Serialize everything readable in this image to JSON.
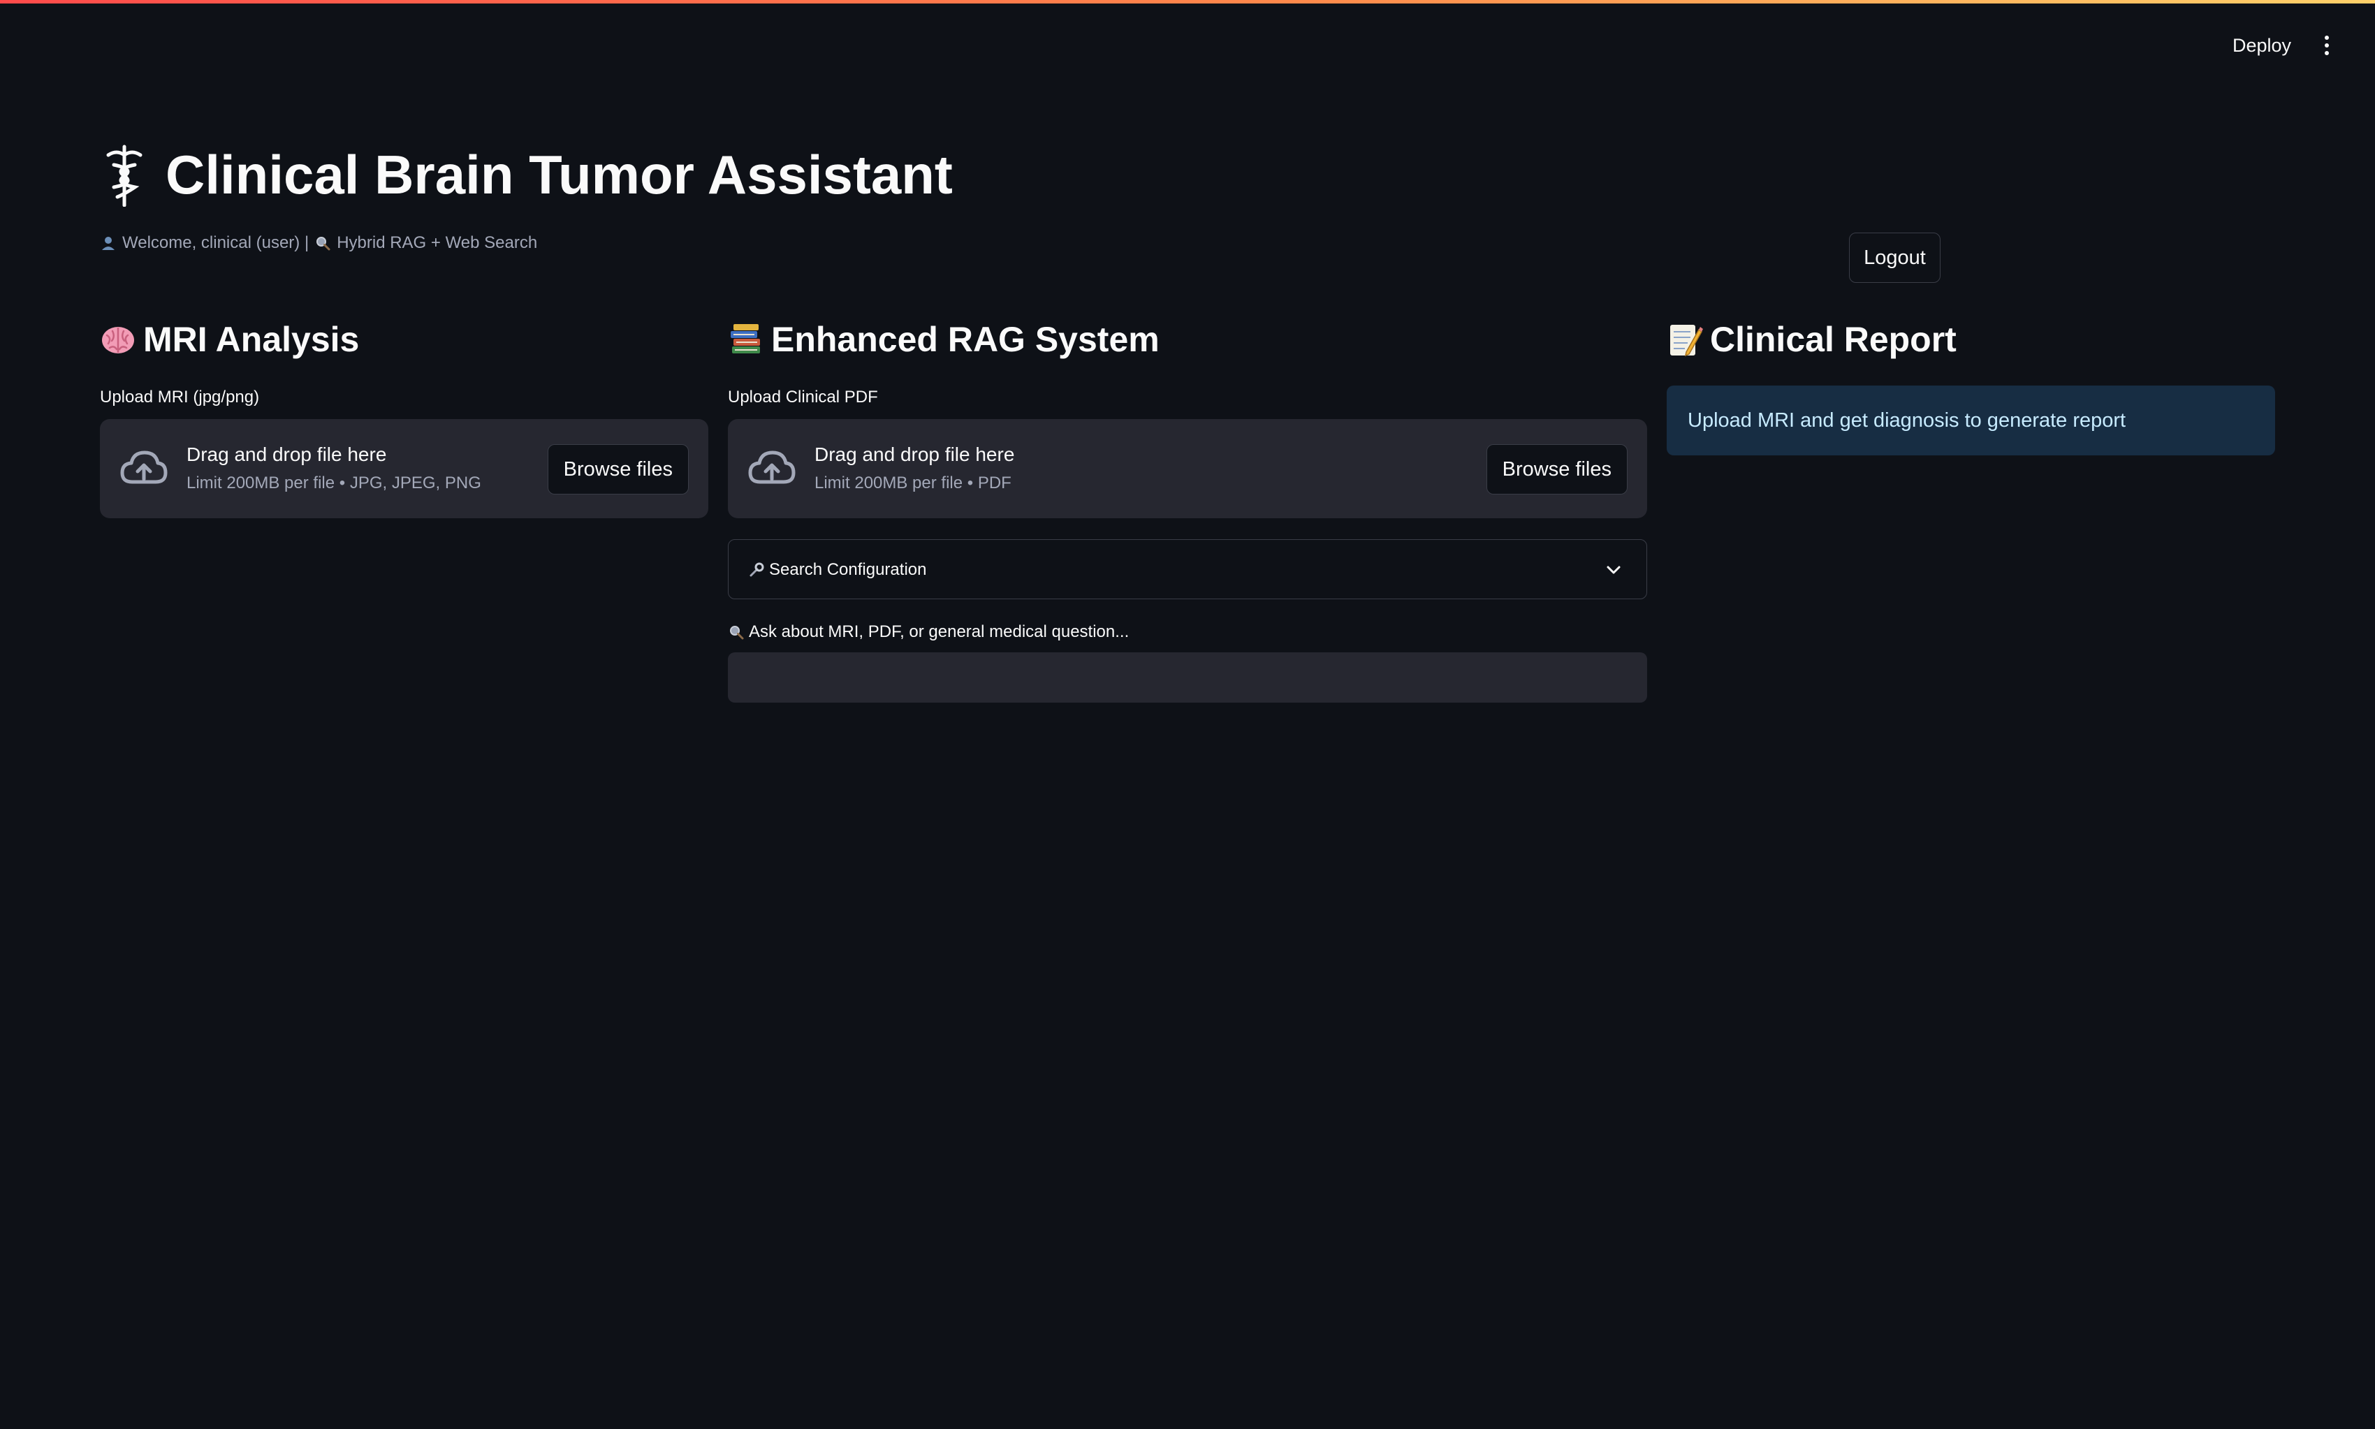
{
  "header": {
    "deploy_label": "Deploy",
    "menu_icon": "kebab-menu-icon"
  },
  "app": {
    "title": "Clinical Brain Tumor Assistant",
    "title_icon": "caduceus-icon",
    "welcome_text": "Welcome, clinical (user) |",
    "mode_text": "Hybrid RAG + Web Search",
    "logout_label": "Logout"
  },
  "mri_section": {
    "header": "MRI Analysis",
    "icon": "brain-icon",
    "upload_label": "Upload MRI (jpg/png)",
    "drag_text": "Drag and drop file here",
    "limit_text": "Limit 200MB per file • JPG, JPEG, PNG",
    "browse_label": "Browse files"
  },
  "rag_section": {
    "header": "Enhanced RAG System",
    "icon": "books-icon",
    "upload_label": "Upload Clinical PDF",
    "drag_text": "Drag and drop file here",
    "limit_text": "Limit 200MB per file • PDF",
    "browse_label": "Browse files",
    "search_config_label": "Search Configuration",
    "question_label": "Ask about MRI, PDF, or general medical question...",
    "question_value": ""
  },
  "report_section": {
    "header": "Clinical Report",
    "icon": "memo-icon",
    "info_text": "Upload MRI and get diagnosis to generate report"
  },
  "colors": {
    "background": "#0e1117",
    "panel": "#262730",
    "info_bg": "#172d43",
    "info_text": "#c7ebff",
    "accent_red": "#ff4b4b"
  }
}
